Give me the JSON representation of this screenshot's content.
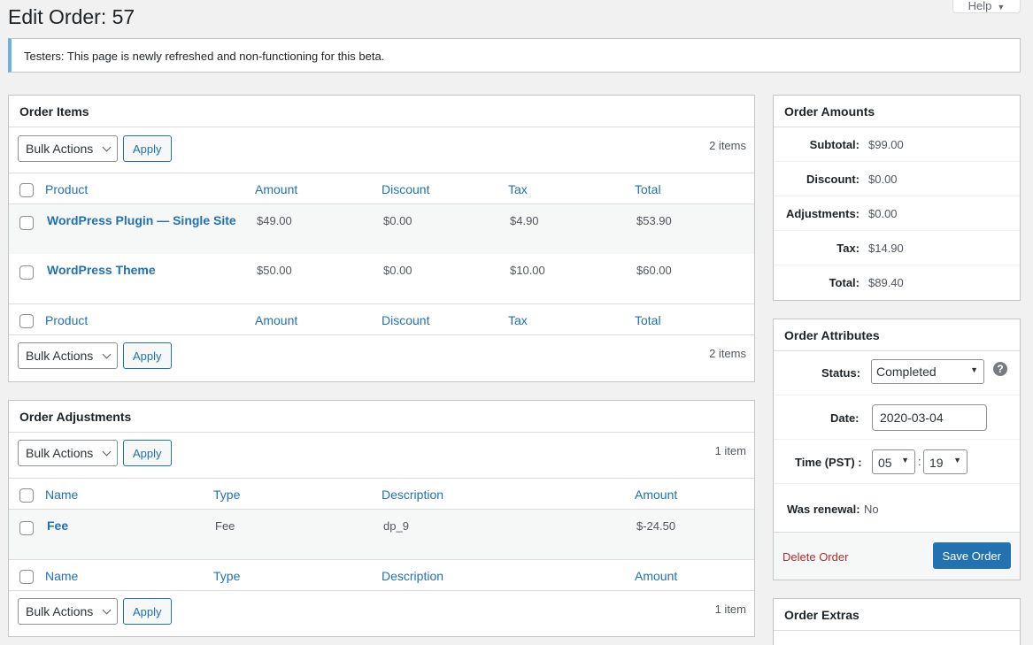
{
  "page": {
    "title": "Edit Order: 57",
    "help_label": "Help"
  },
  "notice": {
    "text": "Testers: This page is newly refreshed and non-functioning for this beta."
  },
  "order_items": {
    "title": "Order Items",
    "bulk_actions_label": "Bulk Actions",
    "apply_label": "Apply",
    "count_text": "2 items",
    "columns": [
      "Product",
      "Amount",
      "Discount",
      "Tax",
      "Total"
    ],
    "rows": [
      {
        "product": "WordPress Plugin — Single Site",
        "amount": "$49.00",
        "discount": "$0.00",
        "tax": "$4.90",
        "total": "$53.90"
      },
      {
        "product": "WordPress Theme",
        "amount": "$50.00",
        "discount": "$0.00",
        "tax": "$10.00",
        "total": "$60.00"
      }
    ]
  },
  "order_adjustments": {
    "title": "Order Adjustments",
    "bulk_actions_label": "Bulk Actions",
    "apply_label": "Apply",
    "count_text": "1 item",
    "columns": [
      "Name",
      "Type",
      "Description",
      "Amount"
    ],
    "rows": [
      {
        "name": "Fee",
        "type": "Fee",
        "description": "dp_9",
        "amount": "$-24.50"
      }
    ]
  },
  "order_amounts": {
    "title": "Order Amounts",
    "rows": [
      {
        "label": "Subtotal:",
        "value": "$99.00"
      },
      {
        "label": "Discount:",
        "value": "$0.00"
      },
      {
        "label": "Adjustments:",
        "value": "$0.00"
      },
      {
        "label": "Tax:",
        "value": "$14.90"
      },
      {
        "label": "Total:",
        "value": "$89.40"
      }
    ]
  },
  "order_attributes": {
    "title": "Order Attributes",
    "status_label": "Status:",
    "status_value": "Completed",
    "date_label": "Date:",
    "date_value": "2020-03-04",
    "time_label": "Time (PST) :",
    "hour_value": "05",
    "time_separator": ":",
    "minute_value": "19",
    "renewal_label": "Was renewal:",
    "renewal_value": "No",
    "delete_label": "Delete Order",
    "save_label": "Save Order"
  },
  "order_extras": {
    "title": "Order Extras"
  },
  "colors": {
    "link": "#2271b1",
    "danger": "#b32d2e",
    "notice_border": "#72aee6"
  }
}
